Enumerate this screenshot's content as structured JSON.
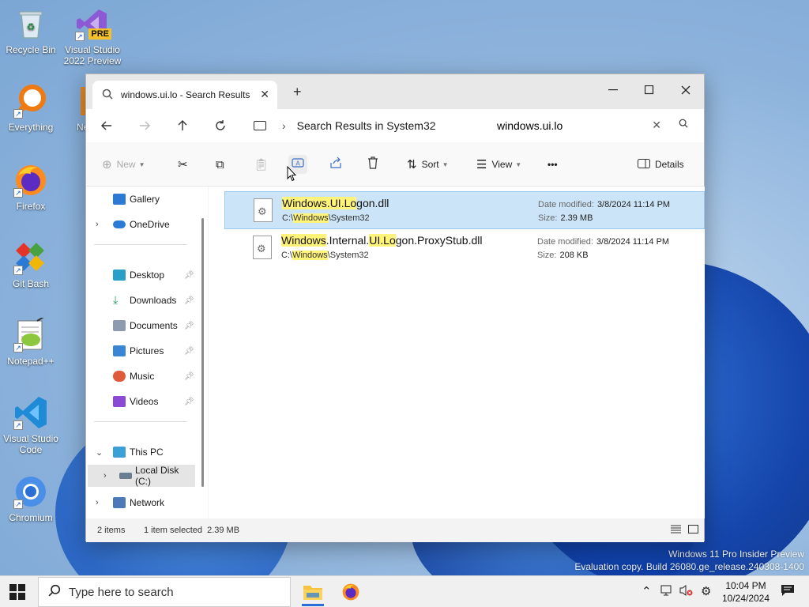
{
  "desktop": {
    "icons": [
      {
        "label": "Recycle Bin",
        "icon": "recycle-bin-icon"
      },
      {
        "label": "Visual Studio 2022 Preview",
        "icon": "visual-studio-icon",
        "badge": "PRE"
      },
      {
        "label": "Everything",
        "icon": "everything-search-icon"
      },
      {
        "label": "Ne",
        "icon": "partial-icon"
      },
      {
        "label": "Firefox",
        "icon": "firefox-icon"
      },
      {
        "label": "Git Bash",
        "icon": "git-bash-icon"
      },
      {
        "label": "Notepad++",
        "icon": "notepad-plus-plus-icon"
      },
      {
        "label": "Visual Studio Code",
        "icon": "vscode-icon"
      },
      {
        "label": "Chromium",
        "icon": "chromium-icon"
      }
    ],
    "watermark": {
      "line1": "Windows 11 Pro Insider Preview",
      "line2": "Evaluation copy. Build 26080.ge_release.240308-1400"
    }
  },
  "explorer": {
    "tab_title": "windows.ui.lo - Search Results",
    "new_tab_symbol": "+",
    "address": {
      "location": "Search Results in System32",
      "search_value": "windows.ui.lo"
    },
    "commands": {
      "new": "New",
      "sort": "Sort",
      "view": "View",
      "more": "•••",
      "details": "Details"
    },
    "nav": {
      "gallery": "Gallery",
      "onedrive": "OneDrive",
      "desktop": "Desktop",
      "downloads": "Downloads",
      "documents": "Documents",
      "pictures": "Pictures",
      "music": "Music",
      "videos": "Videos",
      "this_pc": "This PC",
      "local_disk": "Local Disk (C:)",
      "network": "Network"
    },
    "files": [
      {
        "name_parts": [
          "Windows",
          ".",
          "UI",
          ".",
          "Lo",
          "gon.dll"
        ],
        "path_parts": [
          "C:\\",
          "Windows",
          "\\System32"
        ],
        "date_label": "Date modified:",
        "date": "3/8/2024 11:14 PM",
        "size_label": "Size:",
        "size": "2.39 MB",
        "selected": true
      },
      {
        "name_parts": [
          "Windows",
          ".Internal.",
          "UI",
          ".",
          "Lo",
          "gon.ProxyStub.dll"
        ],
        "path_parts": [
          "C:\\",
          "Windows",
          "\\System32"
        ],
        "date_label": "Date modified:",
        "date": "3/8/2024 11:14 PM",
        "size_label": "Size:",
        "size": "208 KB",
        "selected": false
      }
    ],
    "status": {
      "item_count": "2 items",
      "selection": "1 item selected  2.39 MB"
    }
  },
  "taskbar": {
    "search_placeholder": "Type here to search",
    "clock_time": "10:04 PM",
    "clock_date": "10/24/2024"
  },
  "colors": {
    "selection": "#cce4f7",
    "highlight": "#fff37a",
    "accent": "#2b6fd6"
  }
}
